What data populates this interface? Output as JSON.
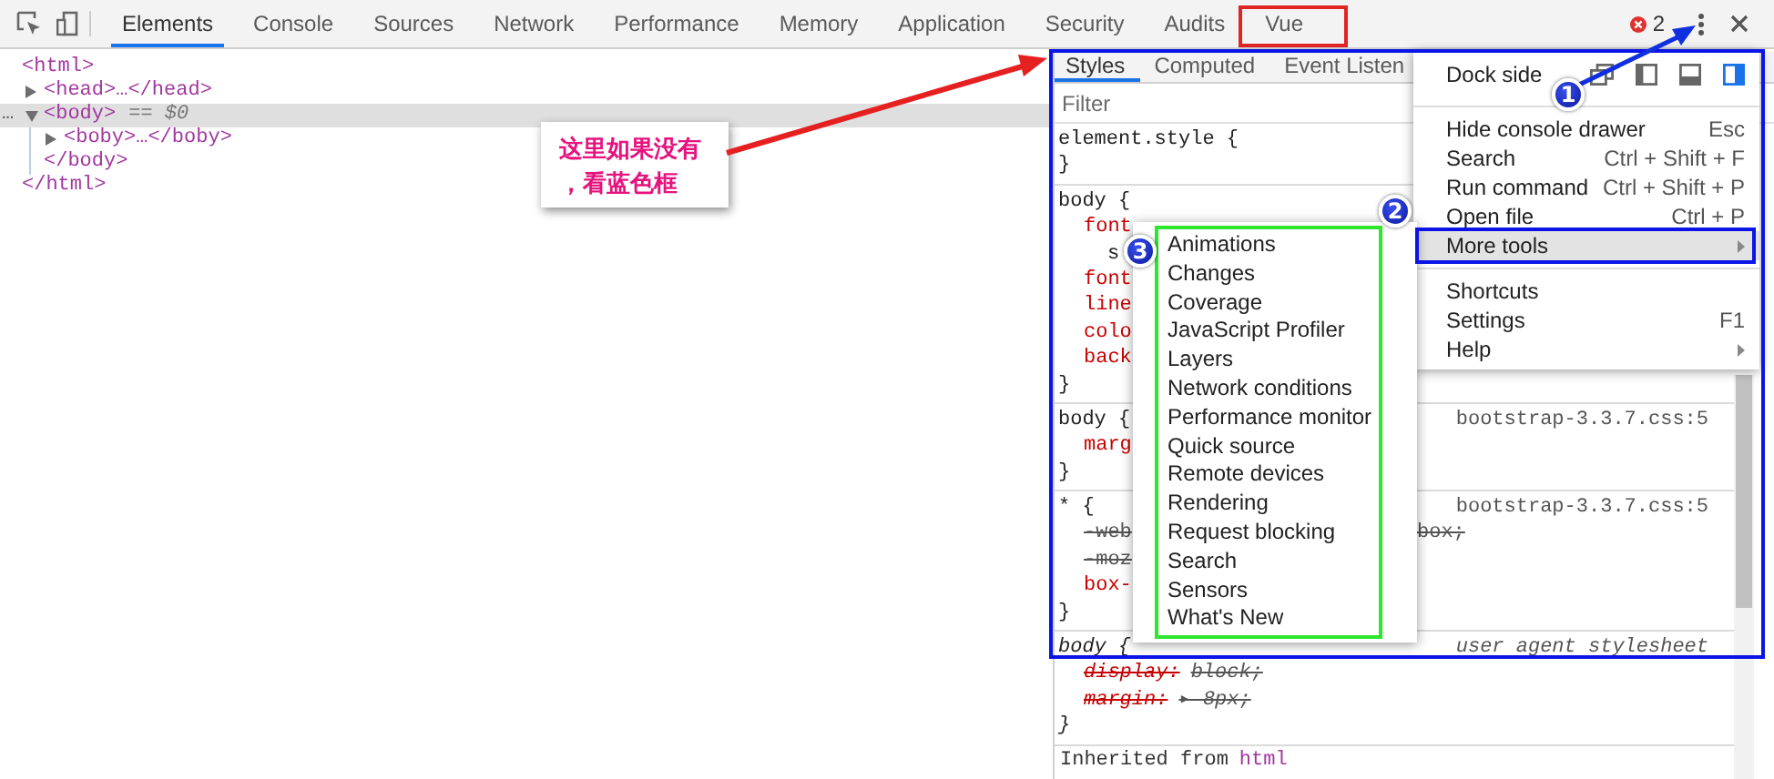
{
  "toolbar": {
    "tabs": [
      {
        "label": "Elements",
        "selected": true
      },
      {
        "label": "Console",
        "selected": false
      },
      {
        "label": "Sources",
        "selected": false
      },
      {
        "label": "Network",
        "selected": false
      },
      {
        "label": "Performance",
        "selected": false
      },
      {
        "label": "Memory",
        "selected": false
      },
      {
        "label": "Application",
        "selected": false
      },
      {
        "label": "Security",
        "selected": false
      },
      {
        "label": "Audits",
        "selected": false
      },
      {
        "label": "Vue",
        "selected": false
      }
    ],
    "error_count": "2"
  },
  "elements_tree": {
    "open": "<html>",
    "close": "</html>",
    "children": [
      {
        "text": "<head>…</head>",
        "expanded": false,
        "selected": false
      },
      {
        "text": "<body>",
        "suffix": "== $0",
        "gutter": "…",
        "expanded": true,
        "selected": true,
        "close": "</body>",
        "children": [
          {
            "text": "<boby>…</boby>",
            "expanded": false,
            "selected": false
          }
        ]
      }
    ]
  },
  "styles_pane": {
    "tabs": [
      {
        "label": "Styles",
        "selected": true
      },
      {
        "label": "Computed",
        "selected": false
      },
      {
        "label": "Event Listen",
        "selected": false
      }
    ],
    "filter": {
      "placeholder": "Filter"
    },
    "rules": [
      {
        "selector": "element.style {",
        "italic": false,
        "close": "}"
      },
      {
        "selector": "body {",
        "italic": false,
        "declarations": [
          {
            "kind": "property",
            "name": "font",
            "struck": false
          },
          {
            "kind": "continuation",
            "name": "s",
            "struck": false
          },
          {
            "kind": "property",
            "name": "font",
            "struck": false
          },
          {
            "kind": "property",
            "name": "line",
            "struck": false
          },
          {
            "kind": "property",
            "name": "colo",
            "struck": false
          },
          {
            "kind": "property",
            "name": "back",
            "struck": false
          }
        ],
        "close": "}"
      },
      {
        "selector": "body {",
        "source": "bootstrap-3.3.7.css:5",
        "italic": false,
        "declarations": [
          {
            "kind": "property",
            "name": "marg",
            "struck": false
          }
        ],
        "close": "}"
      },
      {
        "selector": "* {",
        "source": "bootstrap-3.3.7.css:5",
        "italic": false,
        "declarations": [
          {
            "kind": "property",
            "name": "-web",
            "tail": "box;",
            "struck": true
          },
          {
            "kind": "property",
            "name": "-moz",
            "struck": true
          },
          {
            "kind": "property",
            "name": "box-",
            "struck": false
          }
        ],
        "close": "}"
      },
      {
        "selector": "body {",
        "source": "user agent stylesheet",
        "italic": true,
        "declarations": [
          {
            "kind": "property",
            "name": "display:",
            "value": "block;",
            "struck": true
          },
          {
            "kind": "property",
            "name": "margin:",
            "value": "▸ 8px;",
            "struck": true
          }
        ],
        "close": "}"
      }
    ],
    "inherited": {
      "label": "Inherited from",
      "element": "html"
    }
  },
  "main_menu": {
    "dock_side": {
      "label": "Dock side",
      "options": [
        {
          "kind": "undock",
          "selected": false
        },
        {
          "kind": "left",
          "selected": false
        },
        {
          "kind": "bottom",
          "selected": false
        },
        {
          "kind": "right",
          "selected": true
        }
      ]
    },
    "sections": [
      [
        {
          "label": "Hide console drawer",
          "shortcut": "Esc",
          "has_submenu": false,
          "highlighted": false
        },
        {
          "label": "Search",
          "shortcut": "Ctrl + Shift + F",
          "has_submenu": false,
          "highlighted": false
        },
        {
          "label": "Run command",
          "shortcut": "Ctrl + Shift + P",
          "has_submenu": false,
          "highlighted": false
        },
        {
          "label": "Open file",
          "shortcut": "Ctrl + P",
          "has_submenu": false,
          "highlighted": false
        },
        {
          "label": "More tools",
          "has_submenu": true,
          "highlighted": true
        }
      ],
      [
        {
          "label": "Shortcuts",
          "has_submenu": false,
          "highlighted": false
        },
        {
          "label": "Settings",
          "shortcut": "F1",
          "has_submenu": false,
          "highlighted": false
        },
        {
          "label": "Help",
          "has_submenu": true,
          "highlighted": false
        }
      ]
    ]
  },
  "more_tools_menu": {
    "items": [
      "Animations",
      "Changes",
      "Coverage",
      "JavaScript Profiler",
      "Layers",
      "Network conditions",
      "Performance monitor",
      "Quick source",
      "Remote devices",
      "Rendering",
      "Request blocking",
      "Search",
      "Sensors",
      "What's New"
    ]
  },
  "annotations": {
    "note": "这里如果没有，看蓝色框",
    "badges": [
      "1",
      "2",
      "3"
    ]
  }
}
